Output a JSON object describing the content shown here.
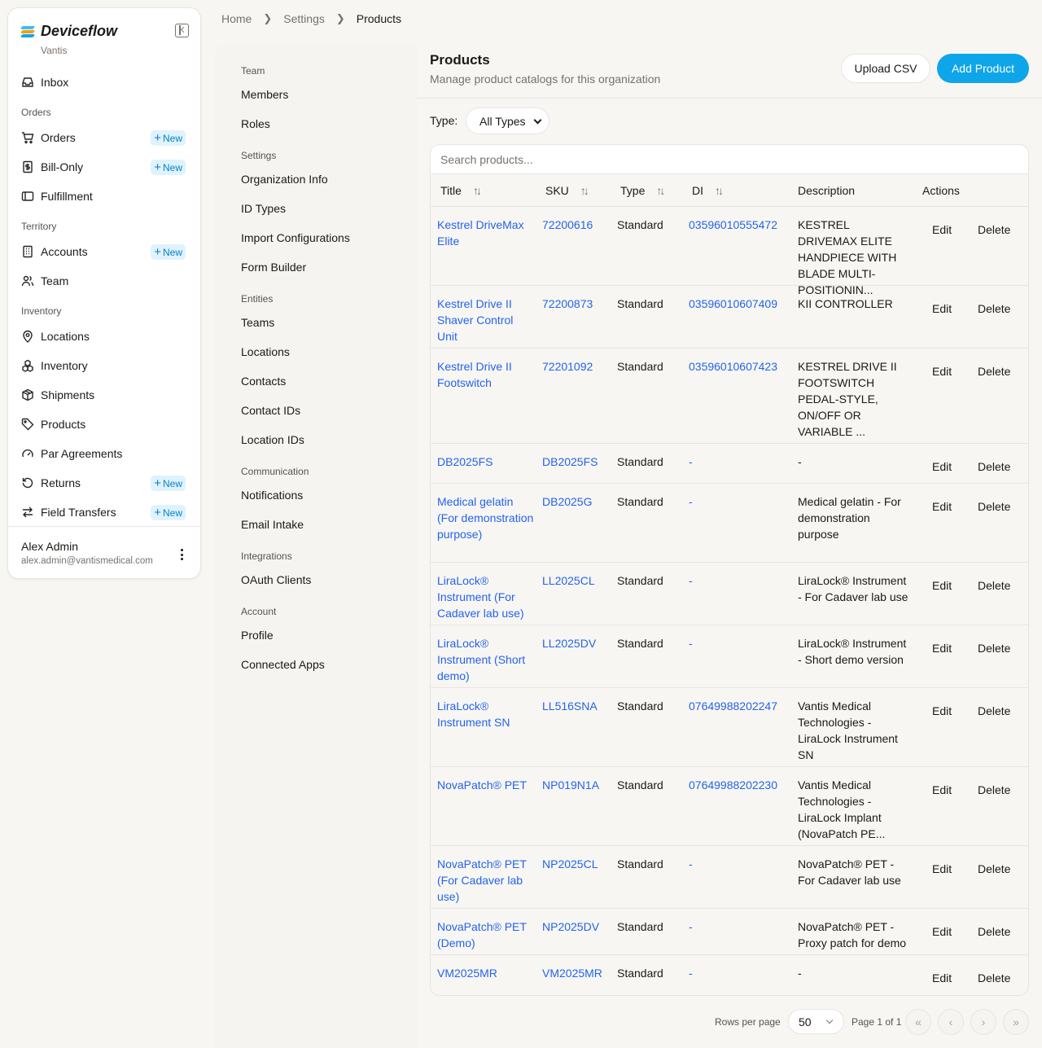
{
  "brand": {
    "name": "Deviceflow",
    "org": "Vantis"
  },
  "sidebar": {
    "inbox": "Inbox",
    "sections": {
      "orders": "Orders",
      "territory": "Territory",
      "inventory": "Inventory"
    },
    "items": {
      "orders": "Orders",
      "bill_only": "Bill-Only",
      "fulfillment": "Fulfillment",
      "accounts": "Accounts",
      "team": "Team",
      "locations": "Locations",
      "inventory": "Inventory",
      "shipments": "Shipments",
      "products": "Products",
      "par_agreements": "Par Agreements",
      "returns": "Returns",
      "field_transfers": "Field Transfers"
    },
    "new_label": "New"
  },
  "user": {
    "name": "Alex Admin",
    "email": "alex.admin@vantismedical.com"
  },
  "breadcrumb": {
    "home": "Home",
    "settings": "Settings",
    "current": "Products"
  },
  "settings_nav": {
    "team_section": "Team",
    "members": "Members",
    "roles": "Roles",
    "settings_section": "Settings",
    "organization_info": "Organization Info",
    "id_types": "ID Types",
    "import_configurations": "Import Configurations",
    "form_builder": "Form Builder",
    "entities_section": "Entities",
    "teams": "Teams",
    "locations": "Locations",
    "contacts": "Contacts",
    "contact_ids": "Contact IDs",
    "location_ids": "Location IDs",
    "communication_section": "Communication",
    "notifications": "Notifications",
    "email_intake": "Email Intake",
    "integrations_section": "Integrations",
    "oauth_clients": "OAuth Clients",
    "account_section": "Account",
    "profile": "Profile",
    "connected_apps": "Connected Apps"
  },
  "page": {
    "title": "Products",
    "subtitle": "Manage product catalogs for this organization",
    "upload_csv": "Upload CSV",
    "add_product": "Add Product",
    "type_label": "Type:",
    "type_value": "All Types",
    "search_placeholder": "Search products..."
  },
  "table": {
    "headers": {
      "title": "Title",
      "sku": "SKU",
      "type": "Type",
      "di": "DI",
      "description": "Description",
      "actions": "Actions"
    },
    "edit_label": "Edit",
    "delete_label": "Delete",
    "rows": [
      {
        "title": "Kestrel DriveMax Elite",
        "sku": "72200616",
        "type": "Standard",
        "di": "03596010555472",
        "description": "KESTREL DRIVEMAX ELITE HANDPIECE WITH BLADE MULTI-POSITIONIN..."
      },
      {
        "title": "Kestrel Drive II Shaver Control Unit",
        "sku": "72200873",
        "type": "Standard",
        "di": "03596010607409",
        "description": "KII CONTROLLER"
      },
      {
        "title": "Kestrel Drive II Footswitch",
        "sku": "72201092",
        "type": "Standard",
        "di": "03596010607423",
        "description": "KESTREL DRIVE II FOOTSWITCH PEDAL-STYLE, ON/OFF OR VARIABLE ..."
      },
      {
        "title": "DB2025FS",
        "sku": "DB2025FS",
        "type": "Standard",
        "di": "-",
        "description": "-"
      },
      {
        "title": "Medical gelatin (For demonstration purpose)",
        "sku": "DB2025G",
        "type": "Standard",
        "di": "-",
        "description": "Medical gelatin - For demonstration purpose"
      },
      {
        "title": "LiraLock® Instrument (For Cadaver lab use)",
        "sku": "LL2025CL",
        "type": "Standard",
        "di": "-",
        "description": "LiraLock® Instrument - For Cadaver lab use"
      },
      {
        "title": "LiraLock® Instrument (Short demo)",
        "sku": "LL2025DV",
        "type": "Standard",
        "di": "-",
        "description": "LiraLock® Instrument - Short demo version"
      },
      {
        "title": "LiraLock® Instrument SN",
        "sku": "LL516SNA",
        "type": "Standard",
        "di": "07649988202247",
        "description": "Vantis Medical Technologies - LiraLock Instrument SN"
      },
      {
        "title": "NovaPatch® PET",
        "sku": "NP019N1A",
        "type": "Standard",
        "di": "07649988202230",
        "description": "Vantis Medical Technologies - LiraLock Implant (NovaPatch PE..."
      },
      {
        "title": "NovaPatch® PET (For Cadaver lab use)",
        "sku": "NP2025CL",
        "type": "Standard",
        "di": "-",
        "description": "NovaPatch® PET - For Cadaver lab use"
      },
      {
        "title": "NovaPatch® PET (Demo)",
        "sku": "NP2025DV",
        "type": "Standard",
        "di": "-",
        "description": "NovaPatch® PET - Proxy patch for demo"
      },
      {
        "title": "VM2025MR",
        "sku": "VM2025MR",
        "type": "Standard",
        "di": "-",
        "description": "-"
      }
    ]
  },
  "pagination": {
    "rows_label": "Rows per page",
    "rows_value": "50",
    "page_info": "Page 1 of 1"
  },
  "colors": {
    "accent": "#0ea5e9",
    "link": "#2563eb",
    "badge_bg": "#e0f2fe",
    "badge_text": "#0284c7"
  }
}
